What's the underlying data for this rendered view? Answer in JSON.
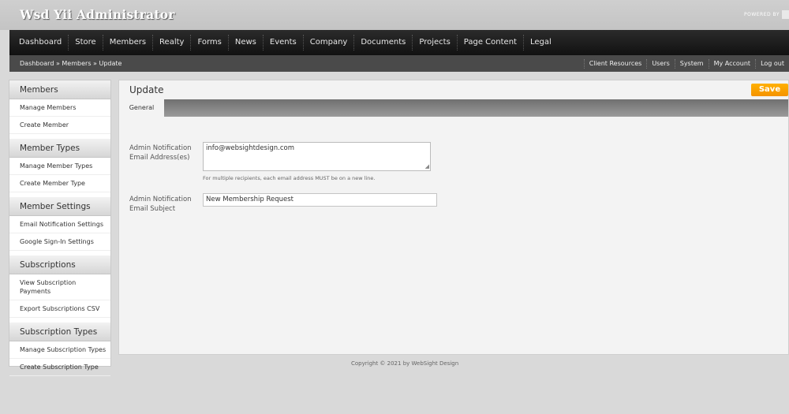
{
  "header": {
    "title": "Wsd Yii Administrator",
    "powered_by": "POWERED BY"
  },
  "nav": {
    "items": [
      "Dashboard",
      "Store",
      "Members",
      "Realty",
      "Forms",
      "News",
      "Events",
      "Company",
      "Documents",
      "Projects",
      "Page Content",
      "Legal"
    ]
  },
  "breadcrumb": {
    "items": [
      "Dashboard",
      "Members",
      "Update"
    ],
    "separator": "»"
  },
  "util_links": [
    "Client Resources",
    "Users",
    "System",
    "My Account",
    "Log out"
  ],
  "sidebar": {
    "sections": [
      {
        "title": "Members",
        "links": [
          "Manage Members",
          "Create Member"
        ]
      },
      {
        "title": "Member Types",
        "links": [
          "Manage Member Types",
          "Create Member Type"
        ]
      },
      {
        "title": "Member Settings",
        "links": [
          "Email Notification Settings",
          "Google Sign-In Settings"
        ]
      },
      {
        "title": "Subscriptions",
        "links": [
          "View Subscription Payments",
          "Export Subscriptions CSV"
        ]
      },
      {
        "title": "Subscription Types",
        "links": [
          "Manage Subscription Types",
          "Create Subscription Type"
        ]
      }
    ]
  },
  "panel": {
    "title": "Update",
    "save_label": "Save",
    "tab_label": "General",
    "email_label_line1": "Admin Notification",
    "email_label_line2": "Email Address(es)",
    "email_value": "info@websightdesign.com",
    "email_hint": "For multiple recipients, each email address MUST be on a new line.",
    "subject_label_line1": "Admin Notification",
    "subject_label_line2": "Email Subject",
    "subject_value": "New Membership Request"
  },
  "footer": {
    "copyright": "Copyright © 2021 by WebSight Design"
  },
  "colors": {
    "save_button": "#f59300",
    "nav_background": "#1a1a1a",
    "subnav_background": "#4a4a4a"
  }
}
